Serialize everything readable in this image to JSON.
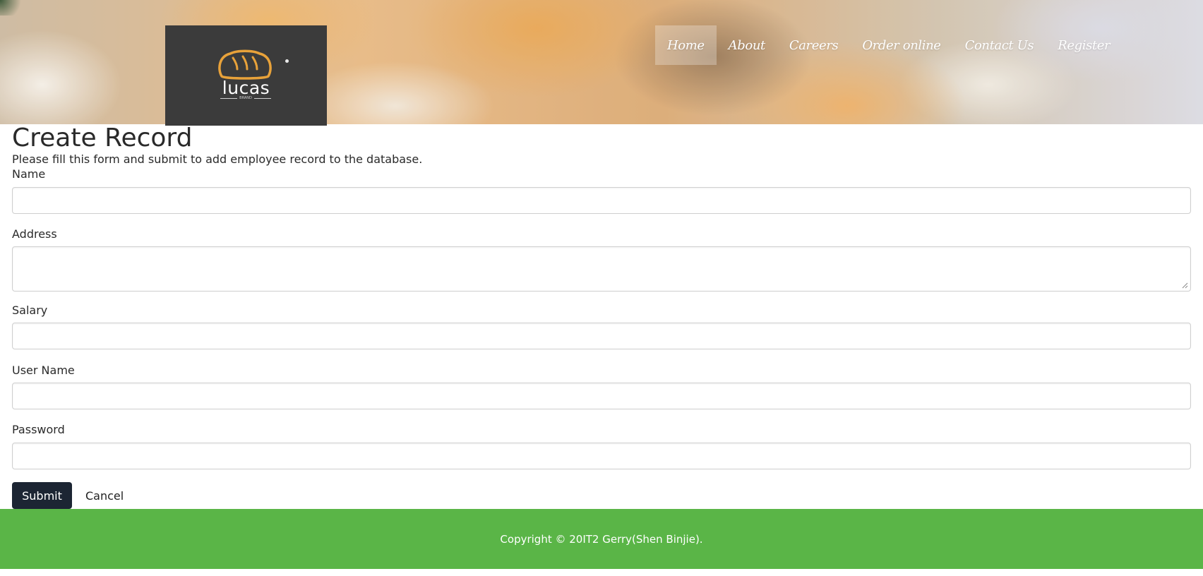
{
  "header": {
    "logo": {
      "brand_name": "lucas",
      "tagline": "BRAND",
      "icon": "bread-icon"
    },
    "nav": [
      {
        "label": "Home",
        "active": true
      },
      {
        "label": "About"
      },
      {
        "label": "Careers"
      },
      {
        "label": "Order online"
      },
      {
        "label": "Contact Us"
      },
      {
        "label": "Register"
      }
    ]
  },
  "form": {
    "title": "Create Record",
    "description": "Please fill this form and submit to add employee record to the database.",
    "fields": [
      {
        "label": "Name",
        "value": ""
      },
      {
        "label": "Address",
        "value": ""
      },
      {
        "label": "Salary",
        "value": ""
      },
      {
        "label": "User Name",
        "value": ""
      },
      {
        "label": "Password",
        "value": ""
      }
    ],
    "submit_label": "Submit",
    "cancel_label": "Cancel"
  },
  "footer": {
    "copyright": "Copyright © 20IT2 Gerry(Shen Binjie)."
  },
  "colors": {
    "footer_bg": "#5ab547",
    "submit_bg": "#1c2533",
    "logo_bg": "#3b3b3b",
    "logo_accent": "#e8a23a"
  }
}
